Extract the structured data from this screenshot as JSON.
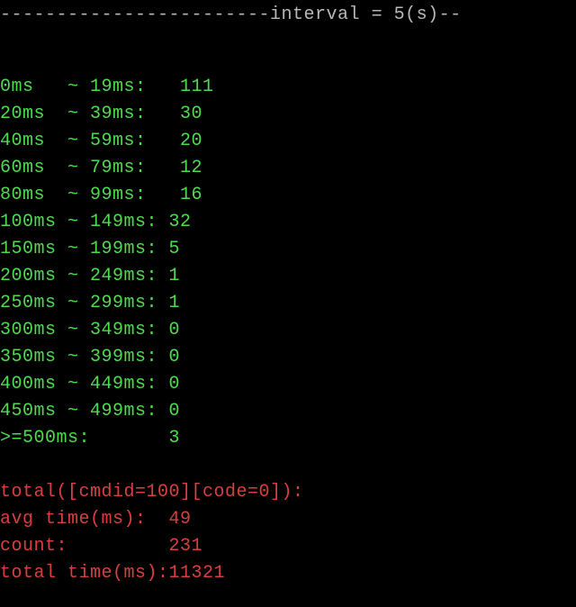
{
  "header": {
    "line": "------------------------interval = 5(s)--"
  },
  "histogram": {
    "rows": [
      {
        "range": "0ms   ~ 19ms:   ",
        "count": "111"
      },
      {
        "range": "20ms  ~ 39ms:   ",
        "count": "30"
      },
      {
        "range": "40ms  ~ 59ms:   ",
        "count": "20"
      },
      {
        "range": "60ms  ~ 79ms:   ",
        "count": "12"
      },
      {
        "range": "80ms  ~ 99ms:   ",
        "count": "16"
      },
      {
        "range": "100ms ~ 149ms: ",
        "count": "32"
      },
      {
        "range": "150ms ~ 199ms: ",
        "count": "5"
      },
      {
        "range": "200ms ~ 249ms: ",
        "count": "1"
      },
      {
        "range": "250ms ~ 299ms: ",
        "count": "1"
      },
      {
        "range": "300ms ~ 349ms: ",
        "count": "0"
      },
      {
        "range": "350ms ~ 399ms: ",
        "count": "0"
      },
      {
        "range": "400ms ~ 449ms: ",
        "count": "0"
      },
      {
        "range": "450ms ~ 499ms: ",
        "count": "0"
      },
      {
        "range": ">=500ms:       ",
        "count": "3"
      }
    ]
  },
  "summary": {
    "title": "total([cmdid=100][code=0]):",
    "rows": [
      {
        "label": "avg time(ms):  ",
        "value": "49"
      },
      {
        "label": "count:         ",
        "value": "231"
      },
      {
        "label": "total time(ms):",
        "value": "11321"
      }
    ]
  },
  "chart_data": {
    "type": "table",
    "title": "Latency histogram, interval = 5(s)",
    "buckets": [
      {
        "low_ms": 0,
        "high_ms": 19,
        "count": 111
      },
      {
        "low_ms": 20,
        "high_ms": 39,
        "count": 30
      },
      {
        "low_ms": 40,
        "high_ms": 59,
        "count": 20
      },
      {
        "low_ms": 60,
        "high_ms": 79,
        "count": 12
      },
      {
        "low_ms": 80,
        "high_ms": 99,
        "count": 16
      },
      {
        "low_ms": 100,
        "high_ms": 149,
        "count": 32
      },
      {
        "low_ms": 150,
        "high_ms": 199,
        "count": 5
      },
      {
        "low_ms": 200,
        "high_ms": 249,
        "count": 1
      },
      {
        "low_ms": 250,
        "high_ms": 299,
        "count": 1
      },
      {
        "low_ms": 300,
        "high_ms": 349,
        "count": 0
      },
      {
        "low_ms": 350,
        "high_ms": 399,
        "count": 0
      },
      {
        "low_ms": 400,
        "high_ms": 449,
        "count": 0
      },
      {
        "low_ms": 450,
        "high_ms": 499,
        "count": 0
      },
      {
        "low_ms": 500,
        "high_ms": null,
        "count": 3
      }
    ],
    "totals": {
      "cmdid": 100,
      "code": 0,
      "avg_time_ms": 49,
      "count": 231,
      "total_time_ms": 11321
    }
  }
}
